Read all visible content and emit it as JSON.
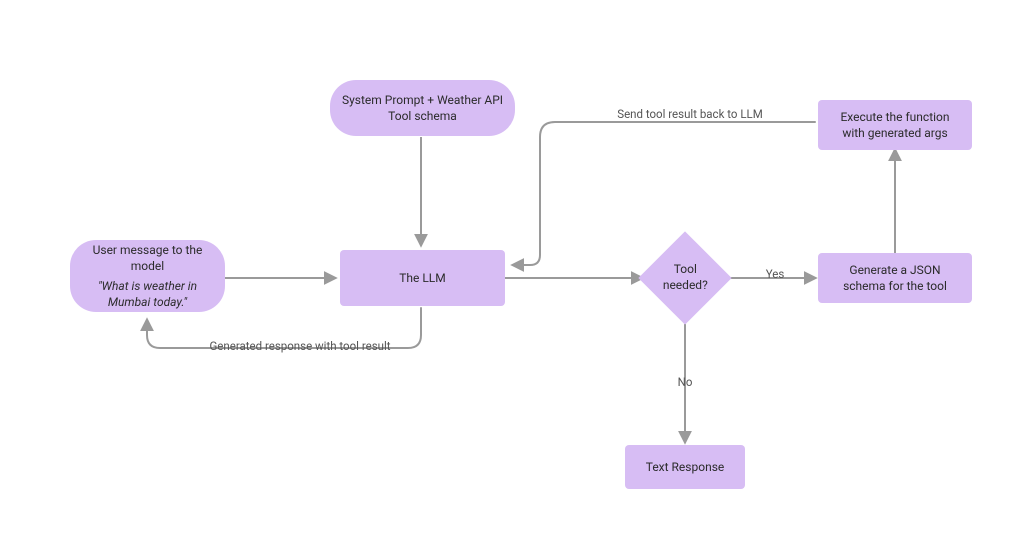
{
  "nodes": {
    "user_message": {
      "title": "User message to the model",
      "quote": "\"What is weather in Mumbai today.\""
    },
    "system_prompt": "System Prompt + Weather API Tool schema",
    "the_llm": "The LLM",
    "tool_needed": "Tool needed?",
    "generate_schema": "Generate a JSON schema for the tool",
    "execute_function": "Execute the function with generated args",
    "text_response": "Text Response"
  },
  "edges": {
    "send_back": "Send tool result back to LLM",
    "generated_response": "Generated response with tool result",
    "yes": "Yes",
    "no": "No"
  },
  "style": {
    "node_fill": "#d7bdf4",
    "arrow_stroke": "#9a9a9a"
  }
}
